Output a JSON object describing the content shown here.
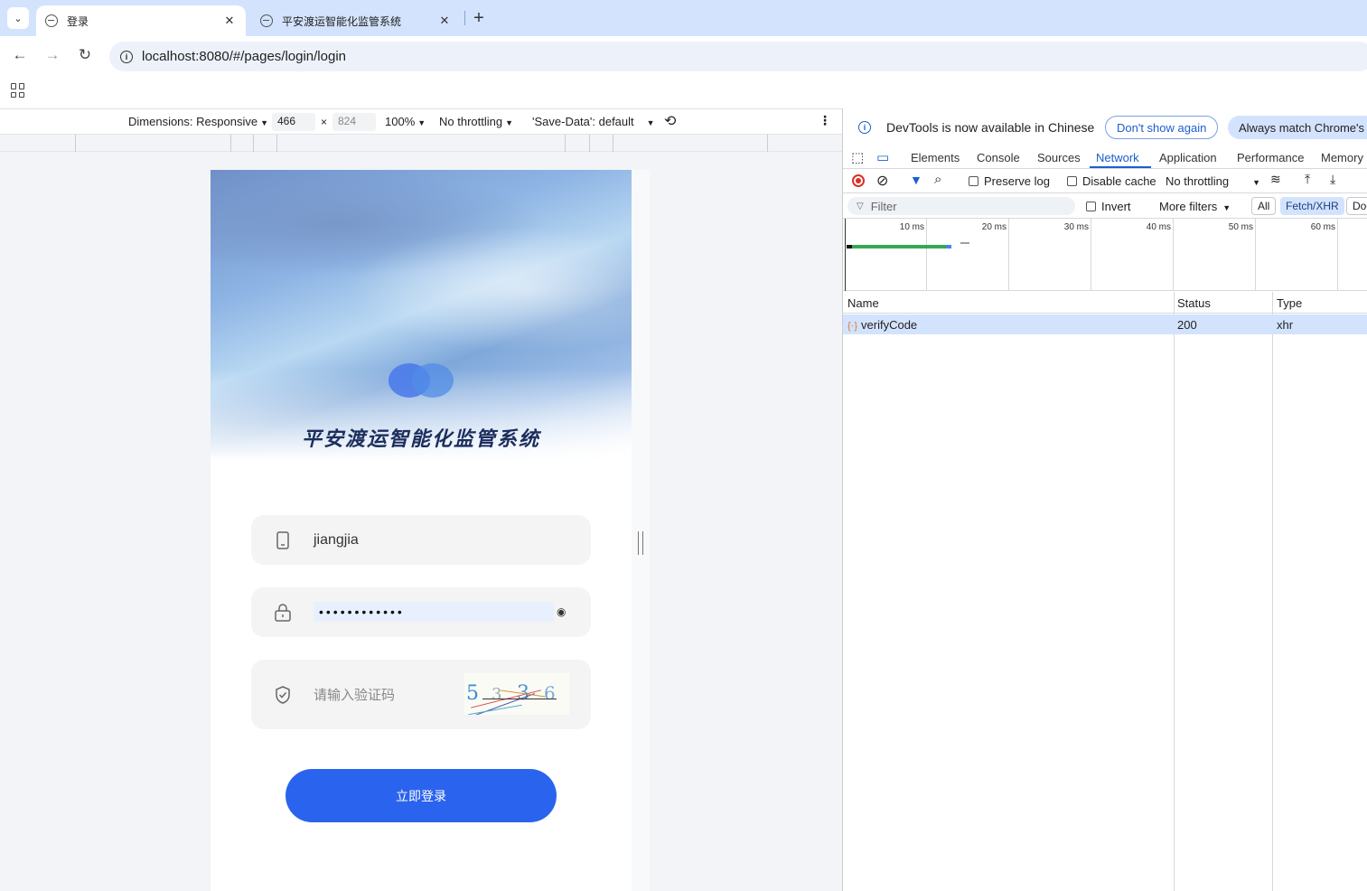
{
  "browser": {
    "tabs": [
      {
        "title": "登录",
        "active": true
      },
      {
        "title": "平安渡运智能化监管系统",
        "active": false
      }
    ],
    "url": "localhost:8080/#/pages/login/login"
  },
  "device_toolbar": {
    "dimensions_label": "Dimensions: Responsive",
    "width": "466",
    "height": "824",
    "zoom": "100%",
    "throttling": "No throttling",
    "save_data": "'Save-Data': default"
  },
  "login_page": {
    "title": "平安渡运智能化监管系统",
    "username": "jiangjia",
    "password_mask": "••••••••••••",
    "captcha_placeholder": "请输入验证码",
    "captcha_chars": [
      "5",
      "3",
      "3",
      "6"
    ],
    "login_button": "立即登录",
    "accent_color": "#2a63ee"
  },
  "devtools": {
    "info_message": "DevTools is now available in Chinese",
    "dont_show_again": "Don't show again",
    "always_match": "Always match Chrome's language",
    "tabs": [
      "Elements",
      "Console",
      "Sources",
      "Network",
      "Application",
      "Performance",
      "Memory"
    ],
    "active_tab": "Network",
    "network_toolbar": {
      "preserve_log": "Preserve log",
      "disable_cache": "Disable cache",
      "throttling": "No throttling"
    },
    "filter": {
      "placeholder": "Filter",
      "invert": "Invert",
      "more_filters": "More filters",
      "all": "All",
      "fetch_xhr": "Fetch/XHR",
      "doc": "Doc"
    },
    "timeline_labels": [
      "10 ms",
      "20 ms",
      "30 ms",
      "40 ms",
      "50 ms",
      "60 ms"
    ],
    "table": {
      "headers": [
        "Name",
        "Status",
        "Type"
      ],
      "rows": [
        {
          "name": "verifyCode",
          "status": "200",
          "type": "xhr"
        }
      ]
    }
  }
}
